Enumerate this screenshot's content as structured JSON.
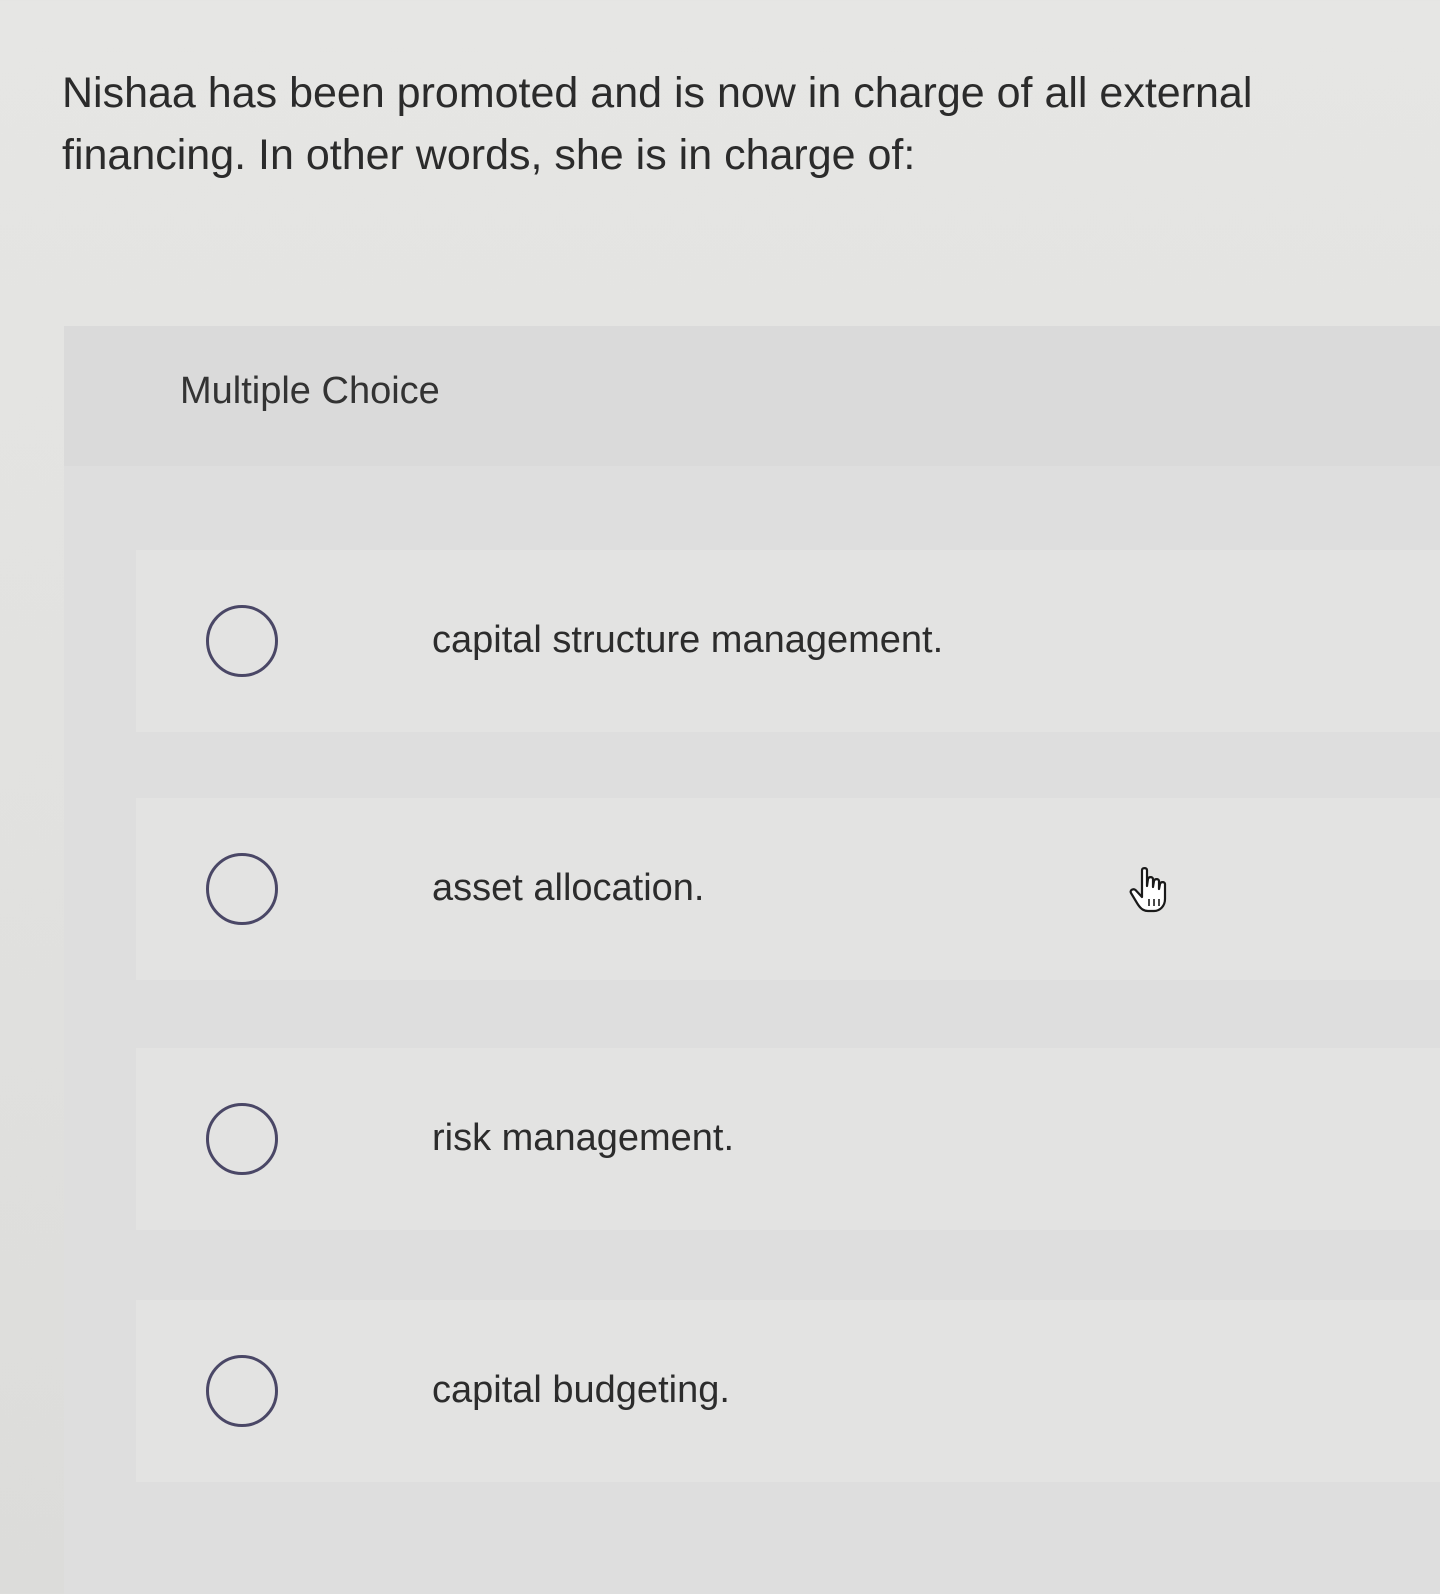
{
  "question": {
    "text": "Nishaa has been promoted and is now in charge of all external financing. In other words, she is in charge of:"
  },
  "panel": {
    "title": "Multiple Choice"
  },
  "options": [
    {
      "label": "capital structure management.",
      "selected": false
    },
    {
      "label": "asset allocation.",
      "selected": false
    },
    {
      "label": "risk management.",
      "selected": false
    },
    {
      "label": "capital budgeting.",
      "selected": false
    }
  ],
  "pointer": {
    "icon": "hand-pointer-icon"
  },
  "colors": {
    "radio_border": "#4a4766",
    "background": "#e3e3e1",
    "text": "#2b2b2b"
  }
}
